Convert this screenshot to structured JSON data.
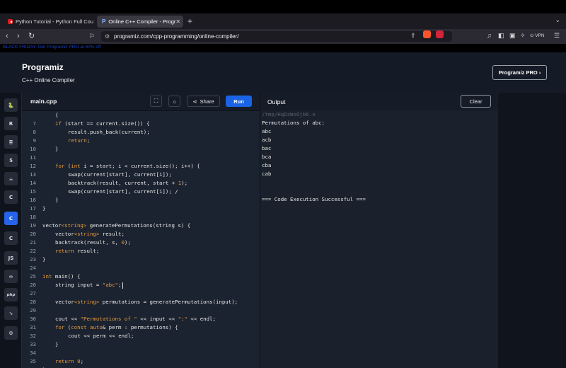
{
  "browser": {
    "tabs": [
      {
        "label": "Python Tutorial - Python Full Cou"
      },
      {
        "label": "Online C++ Compiler - Progr"
      }
    ],
    "new_tab": "+",
    "url": "programiz.com/cpp-programming/online-compiler/",
    "vpn_label": "VPN",
    "link_line": "BLACK FRIDAY: Get Programiz PRO at 60% off"
  },
  "header": {
    "logo_text": "Programiz",
    "subtitle": "C++ Online Compiler",
    "pro_button": "Programiz PRO ›"
  },
  "sidebar": {
    "languages": [
      {
        "name": "python",
        "glyph": "🐍"
      },
      {
        "name": "r",
        "glyph": "R"
      },
      {
        "name": "sql",
        "glyph": "≣"
      },
      {
        "name": "html",
        "glyph": "5"
      },
      {
        "name": "java",
        "glyph": "☕"
      },
      {
        "name": "c",
        "glyph": "C"
      },
      {
        "name": "cpp",
        "glyph": "C"
      },
      {
        "name": "csharp",
        "glyph": "C"
      },
      {
        "name": "js",
        "glyph": "JS"
      },
      {
        "name": "go",
        "glyph": "∞"
      },
      {
        "name": "php",
        "glyph": "php"
      },
      {
        "name": "swift",
        "glyph": "➘"
      },
      {
        "name": "rust",
        "glyph": "⚙"
      }
    ]
  },
  "editor": {
    "file_tab": "main.cpp",
    "share_label": "Share",
    "run_label": "Run",
    "lines": [
      {
        "n": "",
        "t": "{"
      },
      {
        "n": "7",
        "t": "if (start == current.size()) {"
      },
      {
        "n": "8",
        "t": "result.push_back(current);"
      },
      {
        "n": "9",
        "t": "return;"
      },
      {
        "n": "10",
        "t": "}"
      },
      {
        "n": "11",
        "t": ""
      },
      {
        "n": "12",
        "t": "for (int i = start; i < current.size(); i++) {"
      },
      {
        "n": "13",
        "t": "swap(current[start], current[i]);"
      },
      {
        "n": "14",
        "t": "backtrack(result, current, start + 1);"
      },
      {
        "n": "15",
        "t": "swap(current[start], current[i]); /"
      },
      {
        "n": "16",
        "t": "}"
      },
      {
        "n": "17",
        "t": "}"
      },
      {
        "n": "18",
        "t": ""
      },
      {
        "n": "19",
        "t": "vector<string> generatePermutations(string s) {"
      },
      {
        "n": "20",
        "t": "vector<string> result;"
      },
      {
        "n": "21",
        "t": "backtrack(result, s, 0);"
      },
      {
        "n": "22",
        "t": "return result;"
      },
      {
        "n": "23",
        "t": "}"
      },
      {
        "n": "24",
        "t": ""
      },
      {
        "n": "25",
        "t": "int main() {"
      },
      {
        "n": "26",
        "t": "string input = \"abc\";"
      },
      {
        "n": "27",
        "t": ""
      },
      {
        "n": "28",
        "t": "vector<string> permutations = generatePermutations(input);"
      },
      {
        "n": "29",
        "t": ""
      },
      {
        "n": "30",
        "t": "cout << \"Permutations of \" << input << \":\" << endl;"
      },
      {
        "n": "31",
        "t": "for (const auto& perm : permutations) {"
      },
      {
        "n": "32",
        "t": "cout << perm << endl;"
      },
      {
        "n": "33",
        "t": "}"
      },
      {
        "n": "34",
        "t": ""
      },
      {
        "n": "35",
        "t": "return 0;"
      },
      {
        "n": "36",
        "t": "}"
      }
    ]
  },
  "output": {
    "title": "Output",
    "clear_label": "Clear",
    "tmp_path": "/tmp/HqDzWoOjb6.o",
    "lines": [
      "Permutations of abc:",
      "abc",
      "acb",
      "bac",
      "bca",
      "cba",
      "cab",
      "",
      "",
      "=== Code Execution Successful ==="
    ]
  },
  "colors": {
    "run_button": "#1a63e5",
    "active_language": "#2563eb",
    "keyword": "#e59b3c"
  }
}
